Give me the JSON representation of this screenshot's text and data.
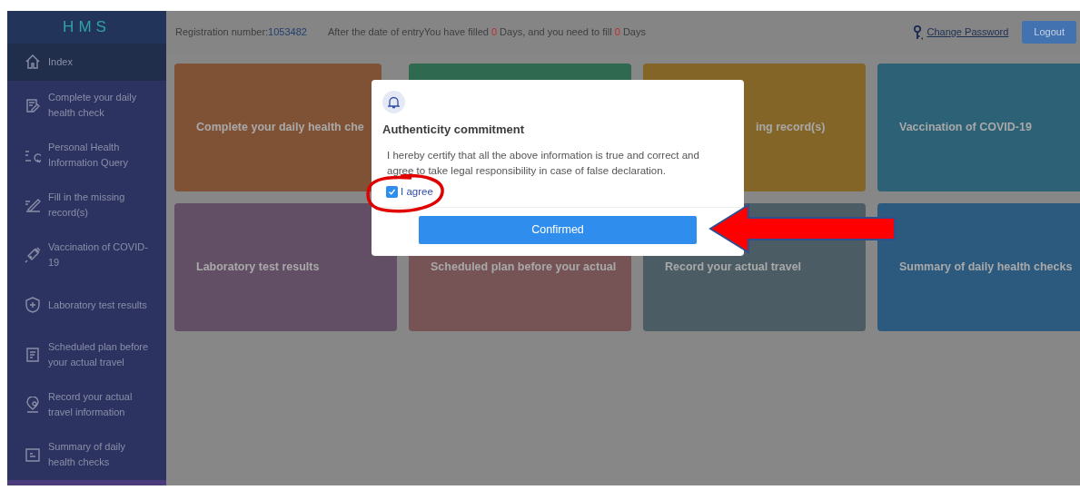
{
  "sidebar": {
    "logo": "HMS",
    "items": [
      {
        "label": "Index",
        "selected": true
      },
      {
        "label": "Complete your daily health check",
        "selected": false
      },
      {
        "label": "Personal Health Information Query",
        "selected": false
      },
      {
        "label": "Fill in the missing record(s)",
        "selected": false
      },
      {
        "label": "Vaccination of COVID-19",
        "selected": false
      },
      {
        "label": "Laboratory test results",
        "selected": false
      },
      {
        "label": "Scheduled plan before your actual travel",
        "selected": false
      },
      {
        "label": "Record your actual travel information",
        "selected": false
      },
      {
        "label": "Summary of daily health checks",
        "selected": false
      }
    ]
  },
  "header": {
    "registration_label": "Registration number:",
    "registration_number": "1053482",
    "notice": [
      {
        "text": "After the date of entryYou have filled ",
        "highlight": false
      },
      {
        "text": "0",
        "highlight": true
      },
      {
        "text": " Days, and you need to fill ",
        "highlight": false
      },
      {
        "text": "0",
        "highlight": true
      },
      {
        "text": " Days",
        "highlight": false
      }
    ],
    "change_password": "Change Password",
    "logout": "Logout"
  },
  "cards": [
    {
      "title": "Complete your daily health che",
      "color": "#7f5236"
    },
    {
      "color": "#2f6950"
    },
    {
      "title": "ing record(s)",
      "color": "#836528"
    },
    {
      "title": "Vaccination of COVID-19",
      "color": "#2d6175"
    },
    {
      "title": "Laboratory test results",
      "color": "#634f65"
    },
    {
      "title": "Scheduled plan before your actual",
      "color": "#765455"
    },
    {
      "title": "Record your actual travel",
      "color": "#4b5c65"
    },
    {
      "title": "Summary of daily health checks",
      "color": "#2c5a7e"
    }
  ],
  "dialog": {
    "title": "Authenticity commitment",
    "body": "I hereby certify that all the above information is true and correct and agree to take legal responsibility in case of false declaration.",
    "agree": {
      "label": "I agree",
      "checked": true
    },
    "confirm": "Confirmed"
  }
}
